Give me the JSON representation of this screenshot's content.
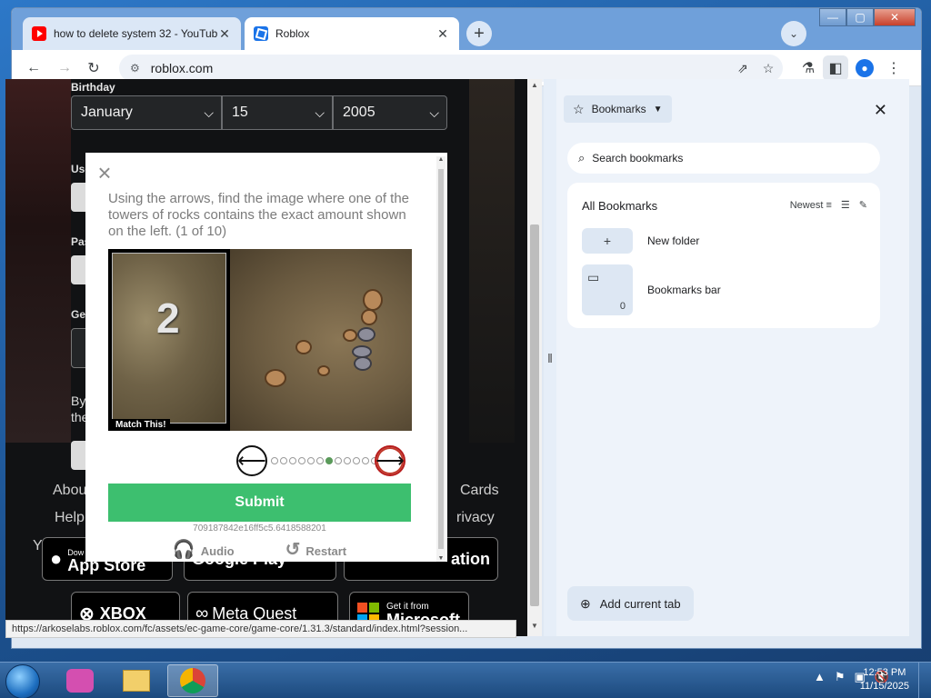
{
  "browser": {
    "tabs": [
      {
        "title": "how to delete system 32 - YouTube",
        "favicon": "youtube-icon"
      },
      {
        "title": "Roblox",
        "favicon": "roblox-icon"
      }
    ],
    "address": "roblox.com",
    "status_url": "https://arkoselabs.roblox.com/fc/assets/ec-game-core/game-core/1.31.3/standard/index.html?session...",
    "window_controls": {
      "minimize": "—",
      "maximize": "▢",
      "close": "✕"
    }
  },
  "page": {
    "birthday_label": "Birthday",
    "month": "January",
    "day": "15",
    "year": "2005",
    "side_labels": [
      "Use",
      "Pas",
      "Ge",
      "By",
      "the"
    ],
    "footer_links": [
      "Abou",
      "Help",
      "Cards",
      "rivacy",
      "Y"
    ],
    "badges": [
      "App Store",
      "Google Play",
      "ation",
      "XBOX",
      "Meta Quest",
      "Microsoft"
    ],
    "badge_small": {
      "apple": "Dow",
      "microsoft": "Get it from"
    }
  },
  "captcha": {
    "instructions": "Using the arrows, find the image where one of the towers of rocks contains the exact amount shown on the left. (1 of 10)",
    "match_number": "2",
    "match_label": "Match This!",
    "prev_arrow": "⟵",
    "next_arrow": "⟶",
    "dots_total": 12,
    "dots_active_index": 6,
    "submit_label": "Submit",
    "session_id": "709187842e16ff5c5.6418588201",
    "audio_label": "Audio",
    "restart_label": "Restart"
  },
  "bookmarks": {
    "header": "Bookmarks",
    "search_placeholder": "Search bookmarks",
    "section_title": "All Bookmarks",
    "sort_label": "Newest",
    "items": [
      {
        "label": "New folder",
        "count": ""
      },
      {
        "label": "Bookmarks bar",
        "count": "0"
      }
    ],
    "add_current_tab": "Add current tab"
  },
  "taskbar": {
    "time": "12:53 PM",
    "date": "11/15/2025"
  },
  "colors": {
    "submit": "#3dbf6f",
    "tab_strip": "#6fa0da",
    "dot_active": "#5a9a5a"
  }
}
